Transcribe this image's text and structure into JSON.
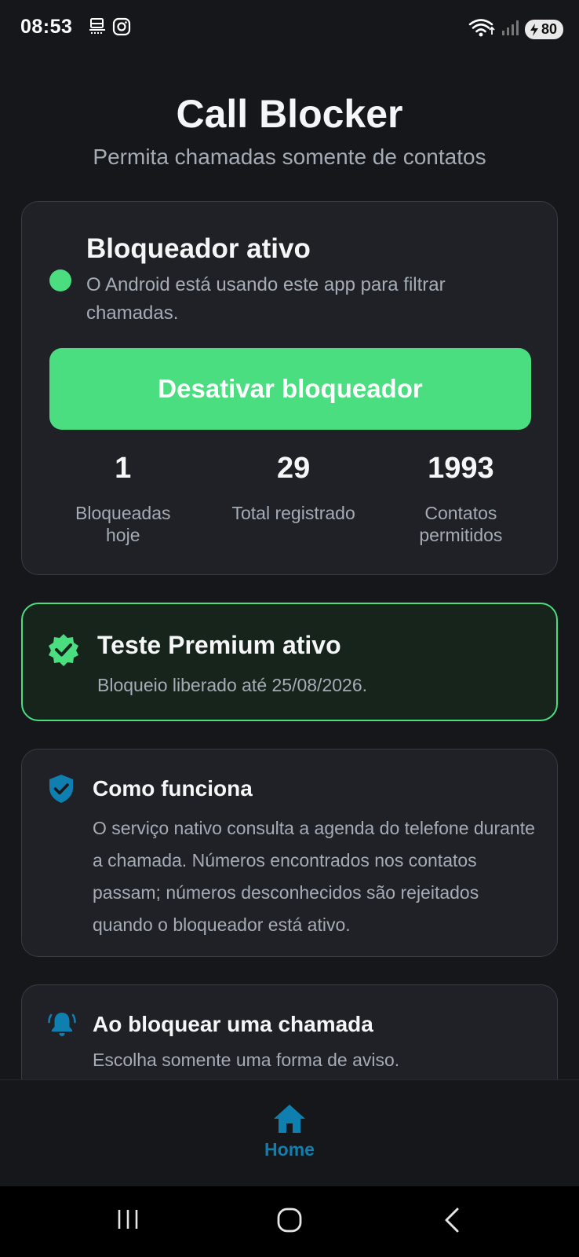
{
  "status_bar": {
    "time": "08:53",
    "battery": "80",
    "icons": [
      "notification-icon",
      "instagram-icon",
      "wifi-icon",
      "signal-icon",
      "battery-icon"
    ]
  },
  "header": {
    "title": "Call Blocker",
    "subtitle": "Permita chamadas somente de contatos"
  },
  "status_card": {
    "title": "Bloqueador ativo",
    "description": "O Android está usando este app para filtrar chamadas.",
    "indicator_color": "#4ade80",
    "button_label": "Desativar bloqueador",
    "stats": [
      {
        "value": "1",
        "label": "Bloqueadas hoje"
      },
      {
        "value": "29",
        "label": "Total registrado"
      },
      {
        "value": "1993",
        "label": "Contatos permitidos"
      }
    ]
  },
  "premium_card": {
    "title": "Teste Premium ativo",
    "description": "Bloqueio liberado até 25/08/2026.",
    "icon": "verified-badge-icon",
    "accent_color": "#4ade80"
  },
  "how_card": {
    "title": "Como funciona",
    "description": "O serviço nativo consulta a agenda do telefone durante a chamada. Números encontrados nos contatos passam; números desconhecidos são rejeitados quando o bloqueador está ativo.",
    "icon": "shield-check-icon"
  },
  "block_card": {
    "title": "Ao bloquear uma chamada",
    "description": "Escolha somente uma forma de aviso.",
    "icon": "bell-icon"
  },
  "bottom_nav": {
    "home_label": "Home",
    "active_color": "#0e7fae"
  }
}
